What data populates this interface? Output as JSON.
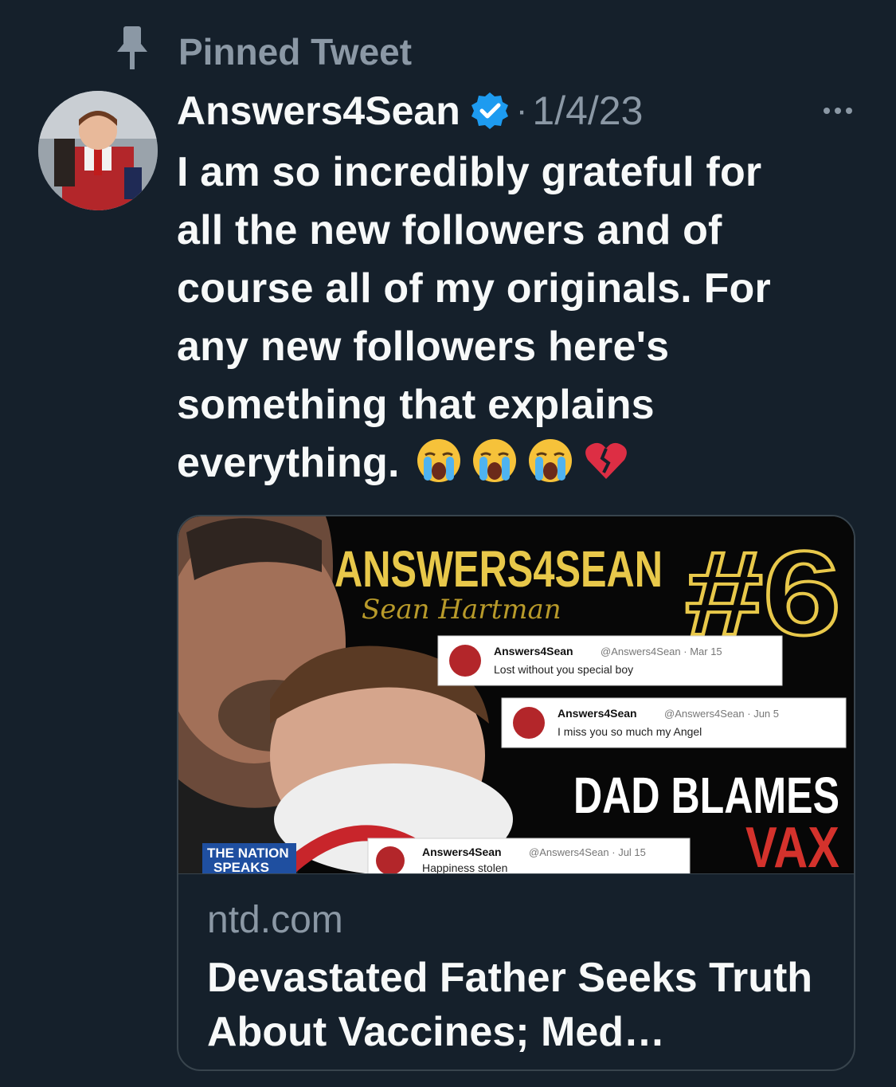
{
  "pinned": {
    "label": "Pinned Tweet",
    "icon": "pin-icon"
  },
  "tweet": {
    "author": "Answers4Sean",
    "verified_icon": "verified-badge-icon",
    "separator": "·",
    "date": "1/4/23",
    "more_icon": "more-options-icon",
    "text_lines": [
      "I am so incredibly grateful for",
      "all the new followers and of",
      "course all of my originals. For",
      "any new followers here's",
      "something that explains",
      "everything."
    ],
    "emojis": [
      "loudly-crying-face",
      "loudly-crying-face",
      "loudly-crying-face",
      "broken-heart"
    ]
  },
  "card": {
    "image": {
      "headline_top": "ANSWERS4SEAN",
      "script_name": "Sean Hartman",
      "number": "#6",
      "headline_1": "DAD BLAMES",
      "headline_2": "VAX",
      "logo_line1": "THE NATION",
      "logo_line2": "SPEAKS",
      "embedded_tweets": [
        {
          "name": "Answers4Sean",
          "handle": "@Answers4Sean · Mar 15",
          "text": "Lost without you special boy"
        },
        {
          "name": "Answers4Sean",
          "handle": "@Answers4Sean · Jun 5",
          "text": "I miss you so much my Angel"
        },
        {
          "name": "Answers4Sean",
          "handle": "@Answers4Sean · Jul 15",
          "text": "Happiness stolen"
        }
      ]
    },
    "domain": "ntd.com",
    "title": "Devastated Father Seeks Truth About Vaccines; Med…"
  },
  "colors": {
    "background": "#15202b",
    "text": "#f7f9f9",
    "muted": "#8b98a5",
    "verified": "#1d9bf0",
    "border": "#38444d",
    "accent_gold": "#e8c84a",
    "accent_red": "#d4322c"
  }
}
